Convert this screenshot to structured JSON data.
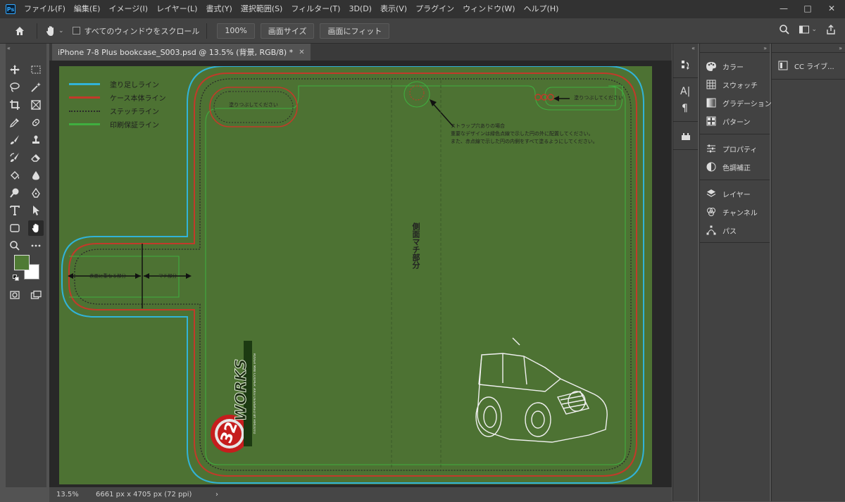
{
  "app": {
    "logo": "Ps"
  },
  "menu": [
    "ファイル(F)",
    "編集(E)",
    "イメージ(I)",
    "レイヤー(L)",
    "書式(Y)",
    "選択範囲(S)",
    "フィルター(T)",
    "3D(D)",
    "表示(V)",
    "プラグイン",
    "ウィンドウ(W)",
    "ヘルプ(H)"
  ],
  "window_controls": {
    "minimize": "—",
    "maximize": "□",
    "close": "✕"
  },
  "options_bar": {
    "scroll_all_label": "すべてのウィンドウをスクロール",
    "zoom_100": "100%",
    "fit_screen": "画面サイズ",
    "fill_screen": "画面にフィット"
  },
  "document": {
    "tab_title": "iPhone 7-8 Plus bookcase_S003.psd @ 13.5% (背景, RGB/8) *",
    "zoom": "13.5%",
    "dimensions": "6661 px x 4705 px (72 ppi)",
    "status_arrow": "›"
  },
  "canvas": {
    "legend": [
      {
        "label": "塗り足しライン",
        "color": "#31b3d8",
        "style": "solid"
      },
      {
        "label": "ケース本体ライン",
        "color": "#c23a2a",
        "style": "solid"
      },
      {
        "label": "ステッチライン",
        "color": "#2a2a2a",
        "style": "dotted"
      },
      {
        "label": "印刷保証ライン",
        "color": "#3fae3f",
        "style": "solid"
      }
    ],
    "paint_over_left": "塗りつぶしてください",
    "paint_over_right": "塗りつぶしてください",
    "strap_note": [
      "ストラップ穴ありの場合",
      "重要なデザインは緑色点線で示した円の外に配置してください。",
      "また、赤点線で示した円の内側をすべて塗るようにしてください。"
    ],
    "side_label": "側面マチ部分",
    "flap_left": "表面に重なる部分",
    "flap_right": "マチ部分",
    "logo_number": "32",
    "logo_text": "WORKS",
    "logo_sub": "ROVER MINI COOPER 3003 DESIGNED BY HIRODTO"
  },
  "panels_a": [
    {
      "icon": "palette-icon",
      "label": "カラー"
    },
    {
      "icon": "swatches-icon",
      "label": "スウォッチ"
    },
    {
      "icon": "gradient-icon",
      "label": "グラデーション"
    },
    {
      "icon": "pattern-icon",
      "label": "パターン"
    },
    {
      "icon": "properties-icon",
      "label": "プロパティ"
    },
    {
      "icon": "adjustments-icon",
      "label": "色調補正"
    },
    {
      "icon": "layers-icon",
      "label": "レイヤー"
    },
    {
      "icon": "channels-icon",
      "label": "チャンネル"
    },
    {
      "icon": "paths-icon",
      "label": "パス"
    }
  ],
  "panels_b": [
    {
      "icon": "cc-libraries-icon",
      "label": "CC ライブ..."
    }
  ],
  "colors": {
    "foreground": "#4f7a34",
    "background": "#ffffff",
    "canvas": "#4d7233",
    "accent": "#31a8ff"
  }
}
